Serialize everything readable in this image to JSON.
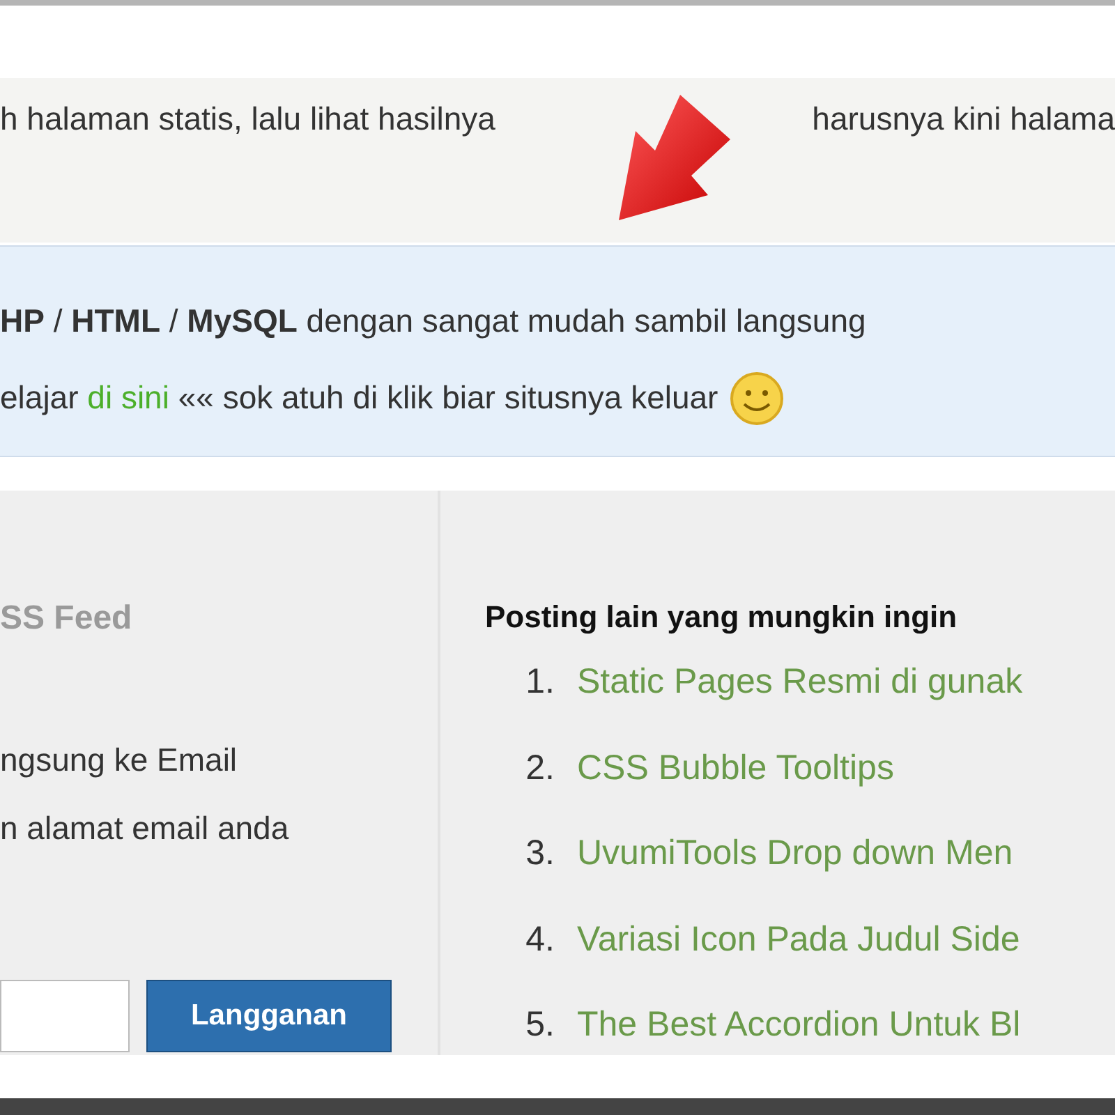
{
  "notice": {
    "text_before": "h halaman statis, lalu lihat hasilnya",
    "text_after": "harusnya kini halama"
  },
  "info_box": {
    "line_1": "**HP** / **HTML** / **MySQL** dengan sangat mudah sambil langsung",
    "line_2_before": "elajar",
    "link": "di sini",
    "line_2_after": "«« sok atuh di klik biar situsnya keluar"
  },
  "subscribe": {
    "title": "SS Feed",
    "lines": [
      "ngsung ke Email",
      "n alamat email anda"
    ],
    "button": "Langganan"
  },
  "related_posts": {
    "heading": "Posting lain yang mungkin ingin",
    "items": [
      {
        "number": "1.",
        "title": "Static Pages Resmi di gunak"
      },
      {
        "number": "2.",
        "title": "CSS Bubble Tooltips"
      },
      {
        "number": "3.",
        "title": "UvumiTools Drop down Men"
      },
      {
        "number": "4.",
        "title": "Variasi Icon Pada Judul Side"
      },
      {
        "number": "5.",
        "title": "The Best Accordion Untuk Bl"
      }
    ]
  }
}
